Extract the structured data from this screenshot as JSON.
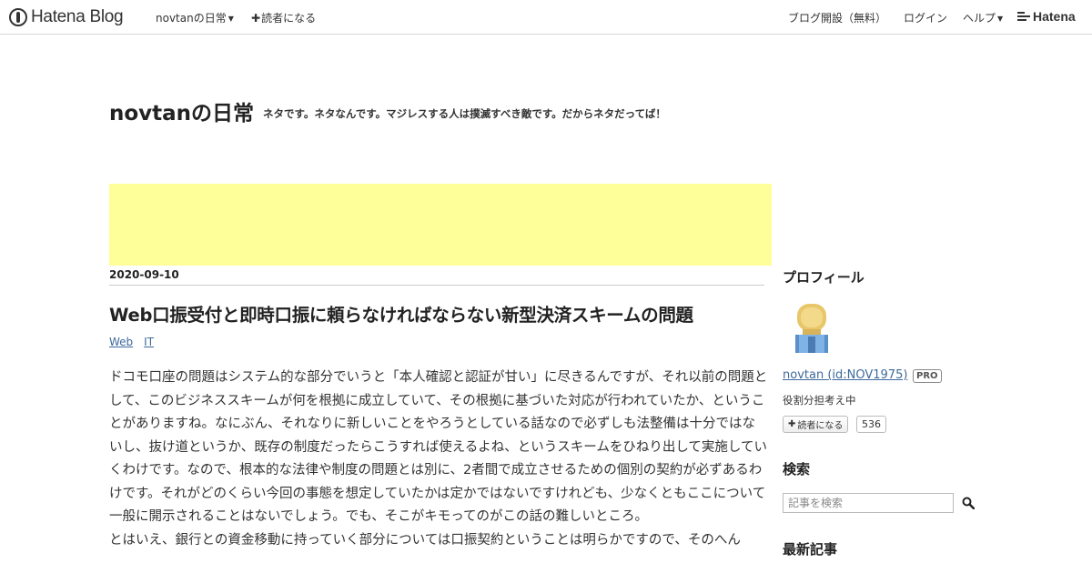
{
  "global_header": {
    "logo_text": "Hatena Blog",
    "blog_menu_label": "novtanの日常",
    "subscribe_label": "読者になる",
    "start_blog_label": "ブログ開設（無料）",
    "login_label": "ログイン",
    "help_label": "ヘルプ",
    "hatena_label": "Hatena"
  },
  "blog": {
    "title": "novtanの日常",
    "description": "ネタです。ネタなんです。マジレスする人は撲滅すべき敵です。だからネタだってば！"
  },
  "colors": {
    "ad_background": "#ffff99",
    "link": "#3d6a9c"
  },
  "entry": {
    "date": "2020-09-10",
    "title": "Web口振受付と即時口振に頼らなければならない新型決済スキームの問題",
    "categories": [
      "Web",
      "IT"
    ],
    "paragraphs": [
      "ドコモ口座の問題はシステム的な部分でいうと「本人確認と認証が甘い」に尽きるんですが、それ以前の問題として、このビジネススキームが何を根拠に成立していて、その根拠に基づいた対応が行われていたか、ということがありますね。なにぶん、それなりに新しいことをやろうとしている話なので必ずしも法整備は十分ではないし、抜け道というか、既存の制度だったらこうすれば使えるよね、というスキームをひねり出して実施していくわけです。なので、根本的な法律や制度の問題とは別に、2者間で成立させるための個別の契約が必ずあるわけです。それがどのくらい今回の事態を想定していたかは定かではないですけれども、少なくともここについて一般に開示されることはないでしょう。でも、そこがキモってのがこの話の難しいところ。",
      "とはいえ、銀行との資金移動に持っていく部分については口振契約ということは明らかですので、そのへん"
    ]
  },
  "sidebar": {
    "profile_heading": "プロフィール",
    "profile_name": "novtan (id:NOV1975)",
    "pro_badge": "PRO",
    "profile_description": "役割分担考え中",
    "subscribe_button": "読者になる",
    "subscriber_count": "536",
    "search_heading": "検索",
    "search_placeholder": "記事を検索",
    "recent_heading": "最新記事"
  }
}
